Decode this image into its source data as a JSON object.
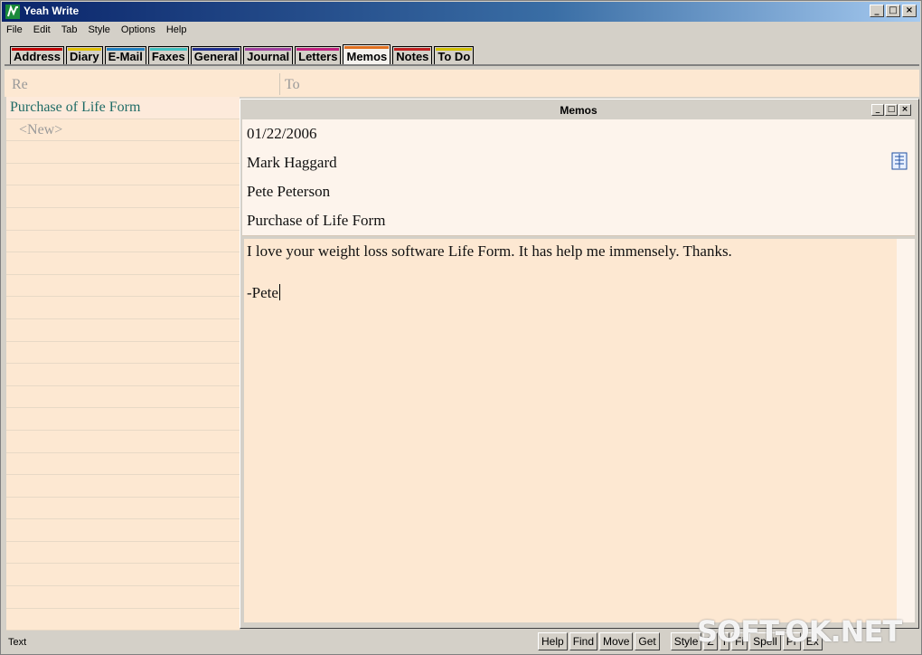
{
  "window": {
    "title": "Yeah Write"
  },
  "menu": [
    "File",
    "Edit",
    "Tab",
    "Style",
    "Options",
    "Help"
  ],
  "tabs": [
    {
      "label": "Address",
      "color": "#c00000"
    },
    {
      "label": "Diary",
      "color": "#e0c000"
    },
    {
      "label": "E-Mail",
      "color": "#2080c0"
    },
    {
      "label": "Faxes",
      "color": "#40c0c0"
    },
    {
      "label": "General",
      "color": "#203090"
    },
    {
      "label": "Journal",
      "color": "#a040a0"
    },
    {
      "label": "Letters",
      "color": "#c02080"
    },
    {
      "label": "Memos",
      "color": "#e07020"
    },
    {
      "label": "Notes",
      "color": "#c02020"
    },
    {
      "label": "To Do",
      "color": "#d0c000"
    }
  ],
  "active_tab": "Memos",
  "header": {
    "re_placeholder": "Re",
    "to_placeholder": "To"
  },
  "list": {
    "items": [
      "Purchase of Life Form",
      "<New>"
    ],
    "selected": "Purchase of Life Form"
  },
  "memo": {
    "window_title": "Memos",
    "date": "01/22/2006",
    "from": "Mark Haggard",
    "to": "Pete Peterson",
    "subject": "Purchase of Life Form",
    "body_line1": "I love your weight loss software Life Form.  It has help me immensely.   Thanks.",
    "body_line2": "-Pete"
  },
  "status": {
    "text": "Text",
    "buttons": [
      "Help",
      "Find",
      "Move",
      "Get",
      "Style",
      "Z",
      "I",
      "Fi",
      "Spell",
      "Pr",
      "Ex"
    ]
  },
  "watermark": "SOFT-OK.NET"
}
